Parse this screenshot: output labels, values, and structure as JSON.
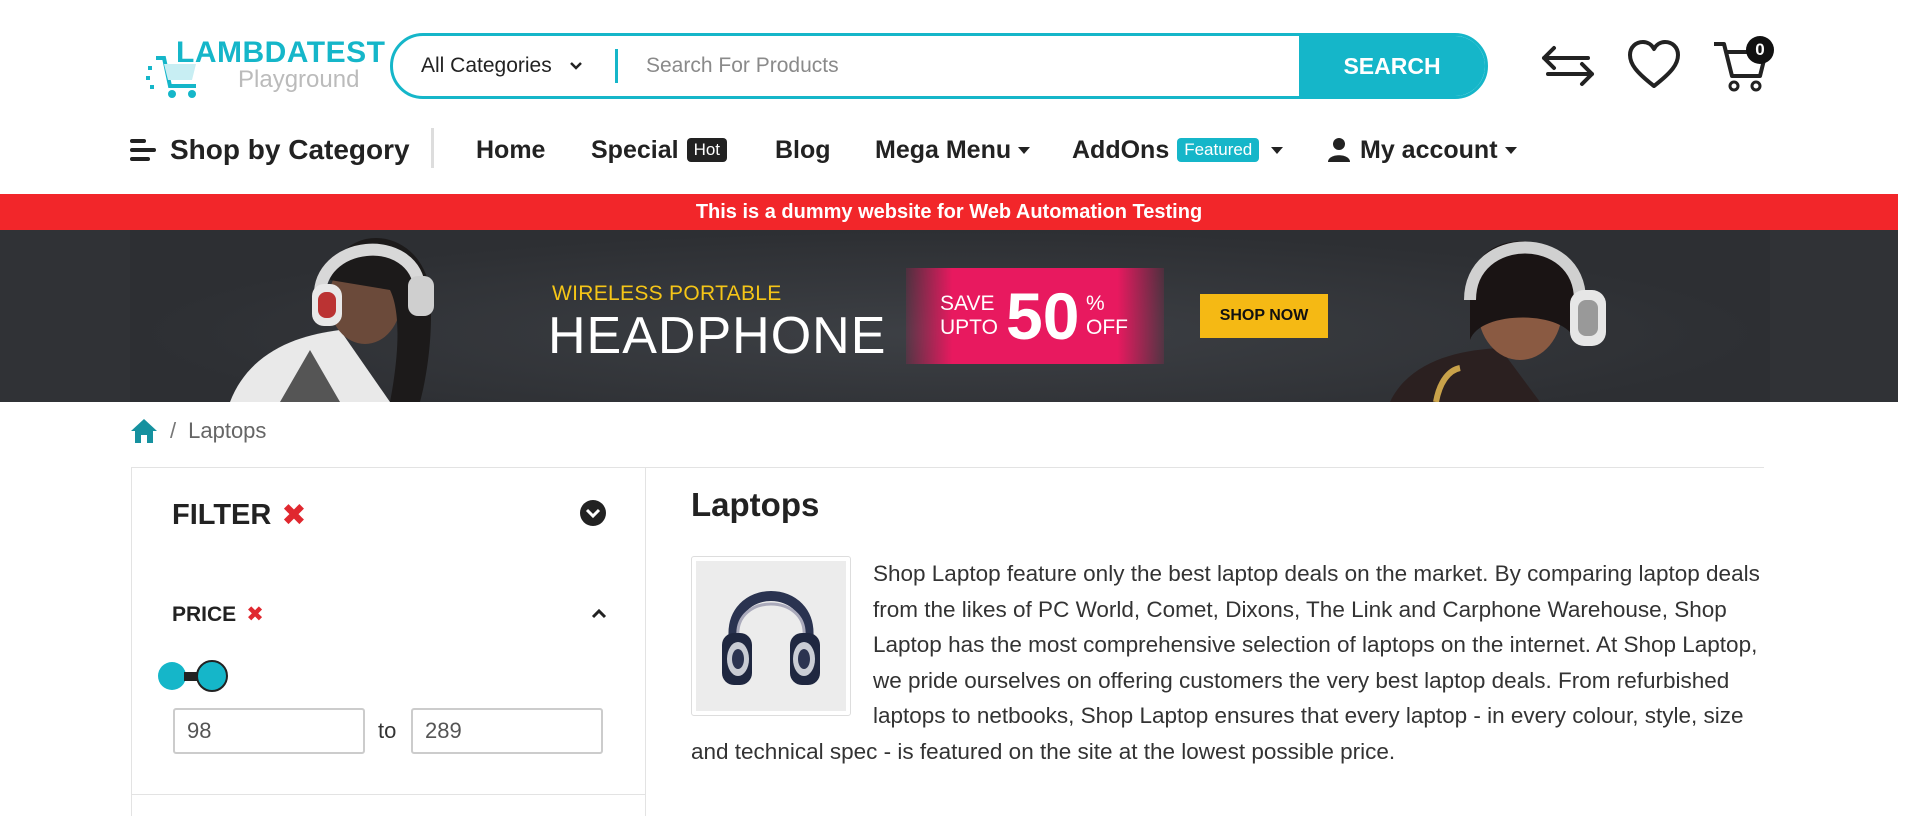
{
  "header": {
    "logo_brand": "LAMBDATEST",
    "logo_sub": "Playground",
    "search": {
      "category_selected": "All Categories",
      "placeholder": "Search For Products",
      "button_label": "SEARCH"
    },
    "cart_count": "0"
  },
  "nav": {
    "shop_by_category": "Shop by Category",
    "items": [
      {
        "label": "Home"
      },
      {
        "label": "Special",
        "badge": "Hot"
      },
      {
        "label": "Blog"
      },
      {
        "label": "Mega Menu"
      },
      {
        "label": "AddOns",
        "badge": "Featured"
      },
      {
        "label": "My account"
      }
    ]
  },
  "notice": "This is a dummy website for Web Automation Testing",
  "banner": {
    "subtitle": "WIRELESS PORTABLE",
    "title": "HEADPHONE",
    "save_line1": "SAVE",
    "save_line2": "UPTO",
    "discount": "50",
    "pct_line1": "%",
    "pct_line2": "OFF",
    "cta": "SHOP NOW"
  },
  "breadcrumb": {
    "separator": "/",
    "current": "Laptops"
  },
  "filter": {
    "title": "FILTER",
    "price_title": "PRICE",
    "min_value": "98",
    "max_value": "289",
    "to_label": "to"
  },
  "category": {
    "title": "Laptops",
    "description": "Shop Laptop feature only the best laptop deals on the market. By comparing laptop deals from the likes of PC World, Comet, Dixons, The Link and Carphone Warehouse, Shop Laptop has the most comprehensive selection of laptops on the internet. At Shop Laptop, we pride ourselves on offering customers the very best laptop deals. From refurbished laptops to netbooks, Shop Laptop ensures that every laptop - in every colour, style, size and technical spec - is featured on the site at the lowest possible price."
  },
  "colors": {
    "accent": "#15b6c9",
    "notice_red": "#f2262a",
    "banner_bg": "#303236",
    "promo_pink": "#e8195f",
    "cta_yellow": "#f5b914"
  }
}
